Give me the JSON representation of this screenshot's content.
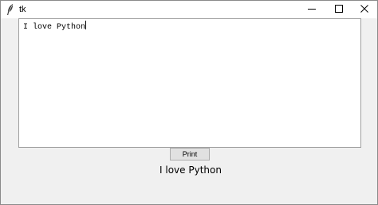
{
  "window": {
    "title": "tk",
    "icons": {
      "app": "feather-icon",
      "minimize": "minimize-icon",
      "maximize": "maximize-icon",
      "close": "close-icon"
    }
  },
  "editor": {
    "value": "I love Python"
  },
  "print_button": {
    "label": "Print"
  },
  "output_label": {
    "text": "I love Python"
  }
}
